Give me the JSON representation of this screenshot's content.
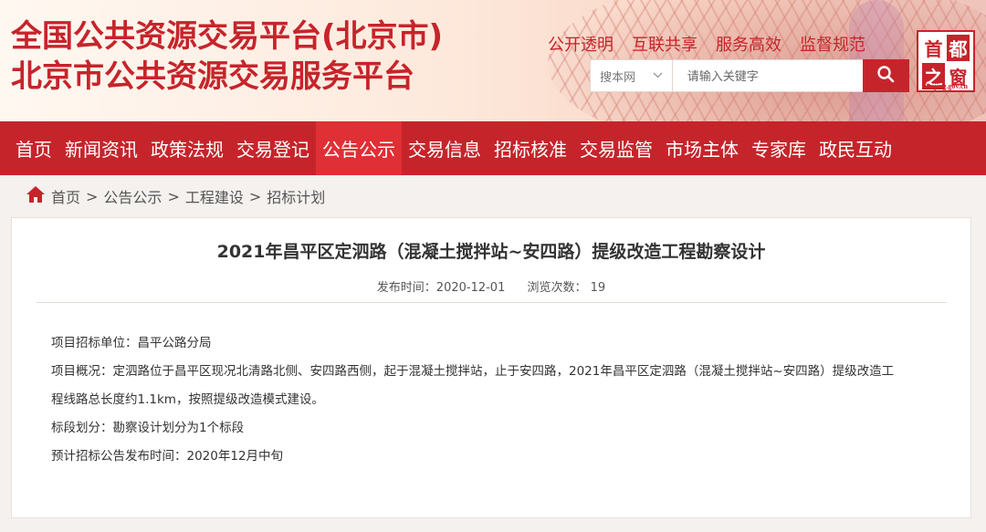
{
  "header": {
    "title_line1": "全国公共资源交易平台(北京市)",
    "title_line2": "北京市公共资源交易服务平台",
    "slogans": [
      "公开透明",
      "互联共享",
      "服务高效",
      "监督规范"
    ],
    "search": {
      "type_label": "搜本网",
      "placeholder": "请输入关键字"
    },
    "logo": {
      "chars": [
        "首",
        "都",
        "之",
        "窗"
      ],
      "caption": "Beijing.gov.cn"
    }
  },
  "nav": {
    "items": [
      "首页",
      "新闻资讯",
      "政策法规",
      "交易登记",
      "公告公示",
      "交易信息",
      "招标核准",
      "交易监管",
      "市场主体",
      "专家库",
      "政民互动"
    ],
    "active_index": 4
  },
  "breadcrumb": {
    "home": "首页",
    "items": [
      "公告公示",
      "工程建设",
      "招标计划"
    ]
  },
  "article": {
    "title": "2021年昌平区定泗路（混凝土搅拌站~安四路）提级改造工程勘察设计",
    "publish_label": "发布时间：2020-12-01",
    "views_label": "浏览次数：  19",
    "lines": [
      "项目招标单位：昌平公路分局",
      "项目概况：定泗路位于昌平区现况北清路北侧、安四路西侧，起于混凝土搅拌站，止于安四路，2021年昌平区定泗路（混凝土搅拌站~安四路）提级改造工",
      "程线路总长度约1.1km，按照提级改造模式建设。",
      "标段划分：勘察设计划分为1个标段",
      "预计招标公告发布时间：2020年12月中旬"
    ]
  },
  "colors": {
    "brand_red": "#c6242b",
    "nav_active": "#e02f35"
  }
}
